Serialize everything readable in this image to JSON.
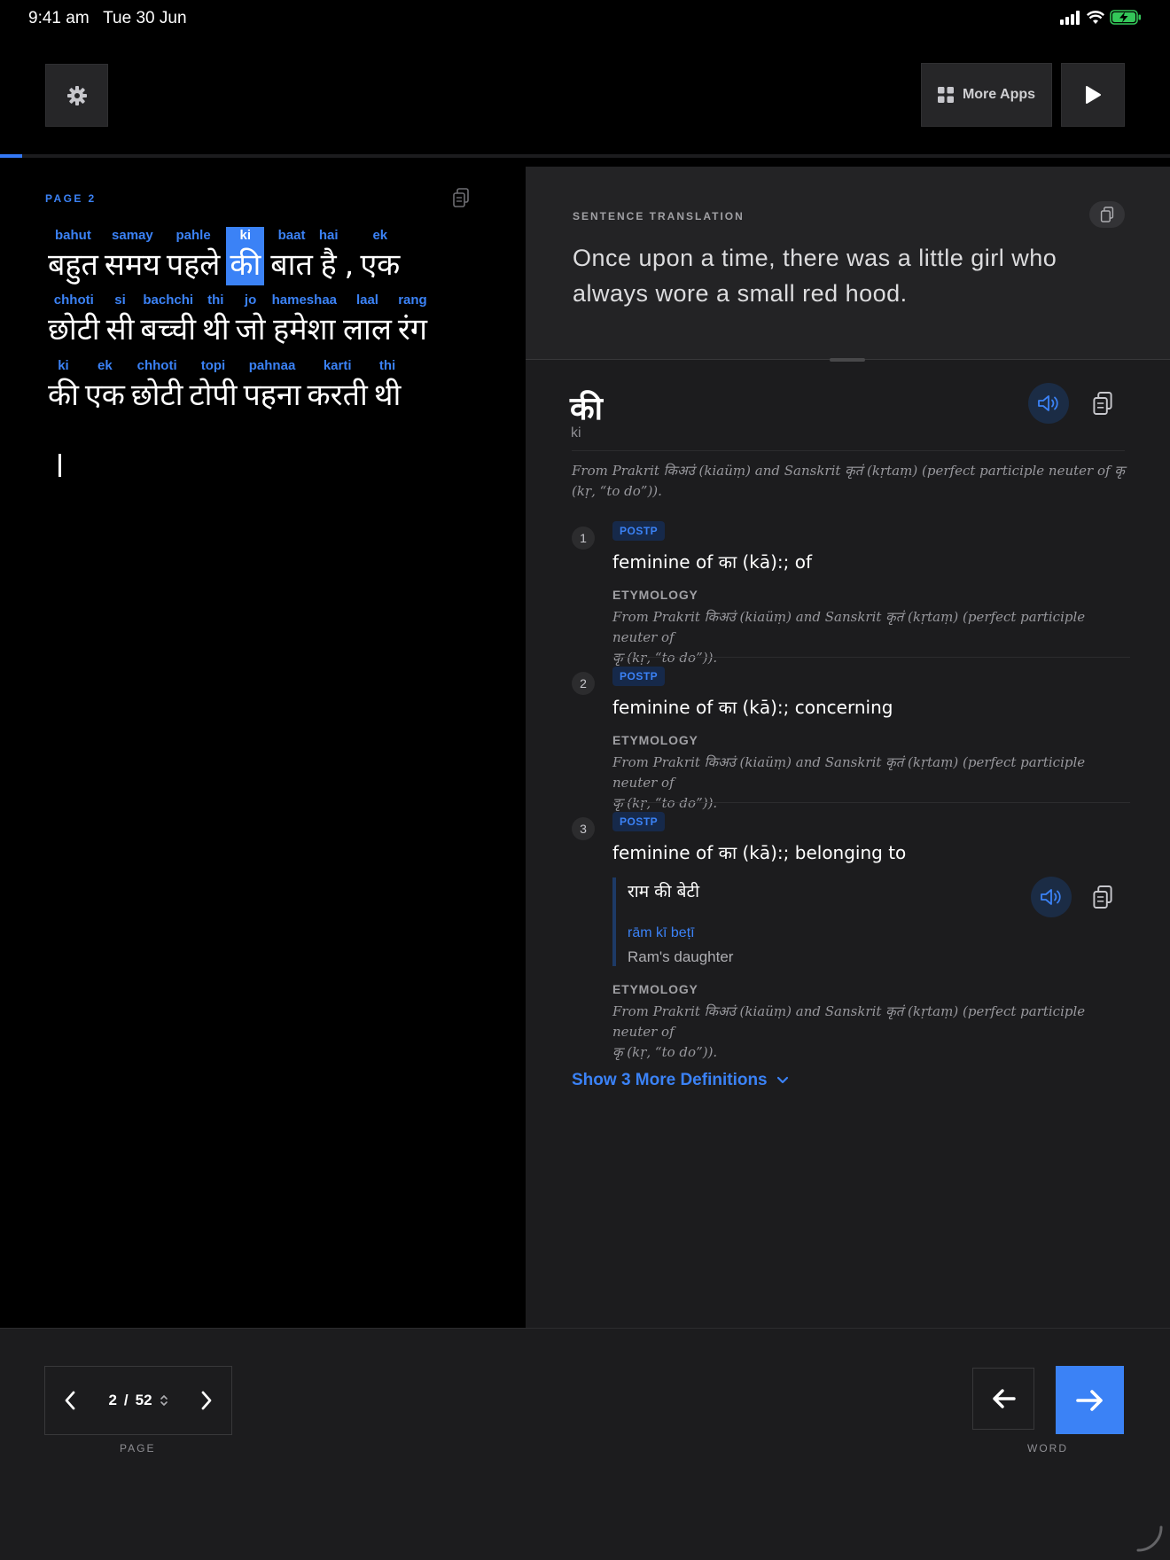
{
  "status_bar": {
    "time": "9:41 am",
    "date": "Tue 30 Jun",
    "icons": [
      "cellular-icon",
      "wifi-icon",
      "battery-charging-icon"
    ]
  },
  "toolbar": {
    "settings_icon": "gear-icon",
    "more_apps_label": "More Apps",
    "play_icon": "play-icon"
  },
  "progress": {
    "fraction": 0.019
  },
  "reader": {
    "page_label": "PAGE 2",
    "lines": [
      [
        {
          "rom": "bahut",
          "hin": "बहुत"
        },
        {
          "rom": "samay",
          "hin": "समय"
        },
        {
          "rom": "pahle",
          "hin": "पहले"
        },
        {
          "rom": "ki",
          "hin": "की",
          "selected": true
        },
        {
          "rom": "baat",
          "hin": "बात"
        },
        {
          "rom": "hai",
          "hin": "है"
        },
        {
          "rom": "",
          "hin": ","
        },
        {
          "rom": "ek",
          "hin": "एक"
        }
      ],
      [
        {
          "rom": "chhoti",
          "hin": "छोटी"
        },
        {
          "rom": "si",
          "hin": "सी"
        },
        {
          "rom": "bachchi",
          "hin": "बच्ची"
        },
        {
          "rom": "thi",
          "hin": "थी"
        },
        {
          "rom": "jo",
          "hin": "जो"
        },
        {
          "rom": "hameshaa",
          "hin": "हमेशा"
        },
        {
          "rom": "laal",
          "hin": "लाल"
        },
        {
          "rom": "rang",
          "hin": "रंग"
        }
      ],
      [
        {
          "rom": "ki",
          "hin": "की"
        },
        {
          "rom": "ek",
          "hin": "एक"
        },
        {
          "rom": "chhoti",
          "hin": "छोटी"
        },
        {
          "rom": "topi",
          "hin": "टोपी"
        },
        {
          "rom": "pahnaa",
          "hin": "पहना"
        },
        {
          "rom": "karti",
          "hin": "करती"
        },
        {
          "rom": "thi",
          "hin": "थी"
        }
      ]
    ]
  },
  "translation": {
    "label": "SENTENCE TRANSLATION",
    "text": "Once upon a time, there was a little girl who always wore a small red hood."
  },
  "entry": {
    "headword": "की",
    "romanization": "ki",
    "origin": "From Prakrit किअउं (kiaüṃ) and Sanskrit कृतं (kṛtaṃ) (perfect participle neuter of कृ (kṛ, “to do”)).",
    "definitions": [
      {
        "num": "1",
        "pos": "POSTP",
        "text": "feminine of का (kā):; of",
        "ety_label": "ETYMOLOGY",
        "ety": "From Prakrit किअउं (kiaüṃ) and Sanskrit कृतं (kṛtaṃ) (perfect participle neuter of\nकृ (kṛ, “to do”))."
      },
      {
        "num": "2",
        "pos": "POSTP",
        "text": "feminine of का (kā):; concerning",
        "ety_label": "ETYMOLOGY",
        "ety": "From Prakrit किअउं (kiaüṃ) and Sanskrit कृतं (kṛtaṃ) (perfect participle neuter of\nकृ (kṛ, “to do”))."
      },
      {
        "num": "3",
        "pos": "POSTP",
        "text": "feminine of का (kā):; belonging to",
        "ety_label": "ETYMOLOGY",
        "ety": "From Prakrit किअउं (kiaüṃ) and Sanskrit कृतं (kṛtaṃ) (perfect participle neuter of\nकृ (kṛ, “to do”))."
      }
    ],
    "example": {
      "hindi": "राम की बेटी",
      "romanization": "rām kī beṭī",
      "translation": "Ram's daughter"
    },
    "more_label": "Show 3 More Definitions"
  },
  "bottom": {
    "page_current": "2",
    "page_sep": "/",
    "page_total": "52",
    "page_label": "PAGE",
    "word_label": "WORD"
  },
  "colors": {
    "accent": "#3b82f6",
    "background": "#000000",
    "panel": "#1c1c1e"
  }
}
